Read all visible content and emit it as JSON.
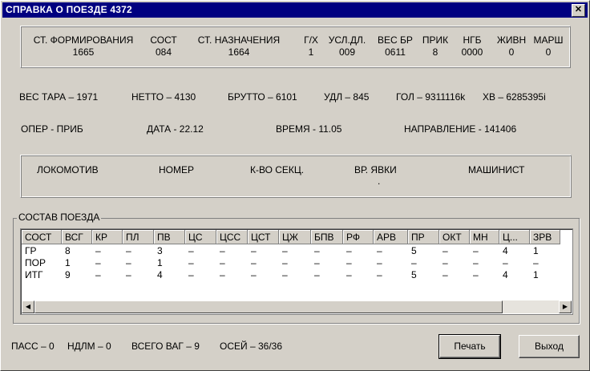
{
  "window": {
    "title": "СПРАВКА О ПОЕЗДЕ 4372",
    "close_glyph": "✕"
  },
  "header": {
    "columns": [
      {
        "label": "СТ. ФОРМИРОВАНИЯ",
        "value": "1665"
      },
      {
        "label": "СОСТ",
        "value": "084"
      },
      {
        "label": "СТ. НАЗНАЧЕНИЯ",
        "value": "1664"
      },
      {
        "label": "Г/Х",
        "value": "1"
      },
      {
        "label": "УСЛ.ДЛ.",
        "value": "009"
      },
      {
        "label": "ВЕС БР",
        "value": "0611"
      },
      {
        "label": "ПРИК",
        "value": "8"
      },
      {
        "label": "НГБ",
        "value": "0000"
      },
      {
        "label": "ЖИВН",
        "value": "0"
      },
      {
        "label": "МАРШ",
        "value": "0"
      }
    ]
  },
  "weights": {
    "ves_tara": "ВЕС  ТАРА – 1971",
    "netto": "НЕТТО –  4130",
    "brutto": "БРУТТО – 6101",
    "udl": "УДЛ – 845",
    "gol": "ГОЛ – 9311116k",
    "hv": "ХВ – 6285395i"
  },
  "operation": {
    "oper": "ОПЕР - ПРИБ",
    "date": "ДАТА - 22.12",
    "time": "ВРЕМЯ - 11.05",
    "direction": "НАПРАВЛЕНИЕ - 141406"
  },
  "locomotive": {
    "headers": [
      "ЛОКОМОТИВ",
      "НОМЕР",
      "К-ВО СЕКЦ.",
      "ВР. ЯВКИ",
      "МАШИНИСТ"
    ],
    "dot": "."
  },
  "sostav": {
    "title": "СОСТАВ ПОЕЗДА",
    "columns": [
      "СОСТ",
      "ВСГ",
      "КР",
      "ПЛ",
      "ПВ",
      "ЦС",
      "ЦСС",
      "ЦСТ",
      "ЦЖ",
      "БПВ",
      "РФ",
      "АРВ",
      "ПР",
      "ОКТ",
      "МН",
      "Ц...",
      "ЗРВ"
    ],
    "rows": [
      [
        "ГР",
        "8",
        "–",
        "–",
        "3",
        "–",
        "–",
        "–",
        "–",
        "–",
        "–",
        "–",
        "5",
        "–",
        "–",
        "4",
        "1"
      ],
      [
        "ПОР",
        "1",
        "–",
        "–",
        "1",
        "–",
        "–",
        "–",
        "–",
        "–",
        "–",
        "–",
        "–",
        "–",
        "–",
        "–",
        "–"
      ],
      [
        "ИТГ",
        "9",
        "–",
        "–",
        "4",
        "–",
        "–",
        "–",
        "–",
        "–",
        "–",
        "–",
        "5",
        "–",
        "–",
        "4",
        "1"
      ]
    ],
    "scroll_left": "◀",
    "scroll_right": "▶"
  },
  "footer": {
    "pass": "ПАСС – 0",
    "ndlm": "НДЛМ – 0",
    "vsego": "ВСЕГО ВАГ –  9",
    "osei": "ОСЕЙ – 36/36",
    "print_label": "Печать",
    "exit_label": "Выход"
  }
}
